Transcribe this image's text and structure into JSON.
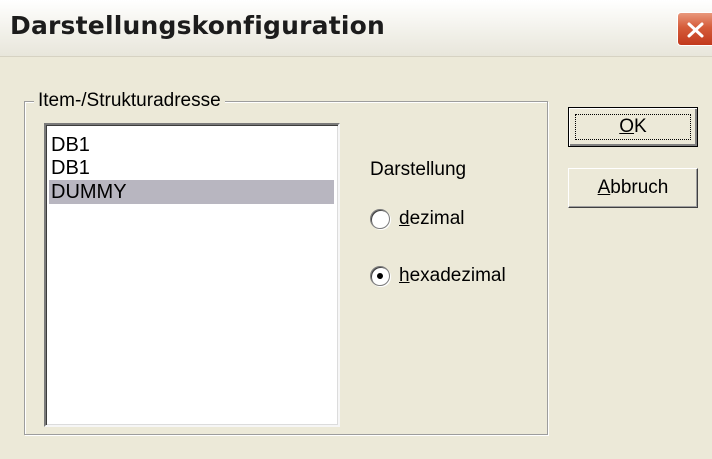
{
  "window": {
    "title": "Darstellungskonfiguration",
    "close_icon": "close-icon"
  },
  "group": {
    "label": "Item-/Strukturadresse"
  },
  "list": {
    "items": [
      "DB1",
      "DB1",
      "DUMMY"
    ],
    "selected_index": 2
  },
  "display": {
    "label": "Darstellung",
    "options": [
      {
        "mnemonic": "d",
        "rest": "ezimal",
        "checked": false
      },
      {
        "mnemonic": "h",
        "rest": "exadezimal",
        "checked": true
      }
    ]
  },
  "buttons": {
    "ok": {
      "mnemonic": "O",
      "rest": "K"
    },
    "cancel": {
      "mnemonic": "A",
      "rest": "bbruch"
    }
  },
  "colors": {
    "dialog_bg": "#ece9d8",
    "selection_bg": "#b8b6c0",
    "close_red": "#d55c3a"
  }
}
